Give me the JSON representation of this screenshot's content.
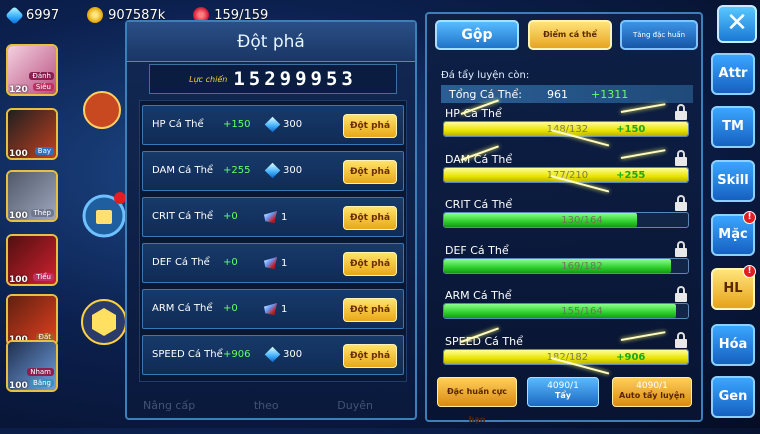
{
  "resources": {
    "gems": "6997",
    "gold": "907587k",
    "energy": "159/159"
  },
  "team": [
    {
      "level": "120",
      "tag": "Siêu",
      "tag_color": "#c03060",
      "side": "Đánh"
    },
    {
      "level": "100",
      "tag": "Bay",
      "tag_color": "#3070c0",
      "side": ""
    },
    {
      "level": "100",
      "tag": "Thép",
      "tag_color": "#707890",
      "side": ""
    },
    {
      "level": "100",
      "tag": "Tiểu",
      "tag_color": "#c03060",
      "side": ""
    },
    {
      "level": "100",
      "tag": "Đất",
      "tag_color": "#a06020",
      "side": ""
    },
    {
      "level": "100",
      "tag": "Băng",
      "tag_color": "#3890c0",
      "side": "Nham"
    }
  ],
  "breakthrough": {
    "title": "Đột phá",
    "power_label": "Lực chiến",
    "power_value": "15299953",
    "rows": [
      {
        "name": "HP Cá Thể",
        "plus": "+150",
        "cost": "300",
        "cost_type": "diamond",
        "button": "Đột phá"
      },
      {
        "name": "DAM Cá Thể",
        "plus": "+255",
        "cost": "300",
        "cost_type": "diamond",
        "button": "Đột phá"
      },
      {
        "name": "CRIT Cá Thể",
        "plus": "+0",
        "cost": "1",
        "cost_type": "chip",
        "button": "Đột phá"
      },
      {
        "name": "DEF Cá Thể",
        "plus": "+0",
        "cost": "1",
        "cost_type": "chip",
        "button": "Đột phá"
      },
      {
        "name": "ARM Cá Thể",
        "plus": "+0",
        "cost": "1",
        "cost_type": "chip",
        "button": "Đột phá"
      },
      {
        "name": "SPEED Cá Thể",
        "plus": "+906",
        "cost": "300",
        "cost_type": "diamond",
        "button": "Đột phá"
      }
    ],
    "bottom_tabs": [
      "Nâng cấp",
      "theo",
      "Duyên"
    ]
  },
  "training": {
    "tab_merge": "Gộp",
    "tab_individual": "Điểm cá thể",
    "tab_special": "Tăng đặc huấn",
    "subtitle": "Đá tẩy luyện còn:",
    "total_label": "Tổng Cá Thể:",
    "total_value": "961",
    "total_plus": "+1311",
    "stats": [
      {
        "name": "HP Cá Thể",
        "value": "148/132",
        "plus": "+150",
        "fill": 1.0,
        "color": "yellow"
      },
      {
        "name": "DAM Cá Thể",
        "value": "177/210",
        "plus": "+255",
        "fill": 1.0,
        "color": "yellow"
      },
      {
        "name": "CRIT Cá Thể",
        "value": "130/164",
        "plus": "",
        "fill": 0.79,
        "color": "green"
      },
      {
        "name": "DEF Cá Thể",
        "value": "169/182",
        "plus": "",
        "fill": 0.93,
        "color": "green"
      },
      {
        "name": "ARM Cá Thể",
        "value": "155/164",
        "plus": "",
        "fill": 0.95,
        "color": "green"
      },
      {
        "name": "SPEED Cá Thể",
        "value": "182/182",
        "plus": "+906",
        "fill": 1.0,
        "color": "yellow"
      }
    ],
    "btn_special": "Đặc huấn cực hạn",
    "btn_wash_count": "4090/1",
    "btn_wash": "Tẩy",
    "btn_auto_count": "4090/1",
    "btn_auto": "Auto tẩy luyện"
  },
  "side_tabs": [
    {
      "label": "Attr",
      "badge": ""
    },
    {
      "label": "TM",
      "badge": ""
    },
    {
      "label": "Skill",
      "badge": ""
    },
    {
      "label": "Mặc",
      "badge": "!"
    },
    {
      "label": "HL",
      "badge": "!"
    },
    {
      "label": "Hóa",
      "badge": ""
    },
    {
      "label": "Gen",
      "badge": ""
    }
  ],
  "close_glyph": "✕"
}
